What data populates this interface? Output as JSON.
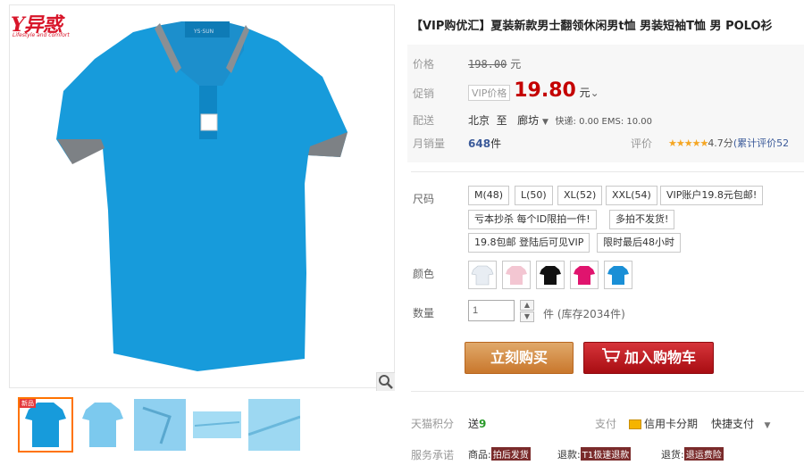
{
  "brand": {
    "logo": "Y异惑",
    "tagline": "Lifestyle and comfort"
  },
  "product": {
    "title": "【VIP购优汇】夏装新款男士翻领休闲男t恤 男装短袖T恤 男 POLO衫",
    "collar_label": "YS·SUN"
  },
  "price": {
    "label": "价格",
    "original": "198.00",
    "currency": "元"
  },
  "promo": {
    "label": "促销",
    "vip_badge": "VIP价格",
    "price": "19.80",
    "unit": "元"
  },
  "shipping": {
    "label": "配送",
    "from": "北京",
    "to_word": "至",
    "dest": "廊坊",
    "fee": "快递: 0.00 EMS: 10.00"
  },
  "sales": {
    "label": "月销量",
    "count": "648",
    "unit": "件",
    "rating_label": "评价",
    "stars": "★★★★★",
    "score": "4.7分",
    "reviews": "(累计评价52"
  },
  "sizes": {
    "label": "尺码",
    "options": [
      "M(48)",
      "L(50)",
      "XL(52)",
      "XXL(54)",
      "VIP账户19.8元包邮!"
    ]
  },
  "notes": [
    "亏本抄杀 每个ID限拍一件!",
    "多拍不发货!",
    "19.8包邮 登陆后可见VIP",
    "限时最后48小时"
  ],
  "colors": {
    "label": "颜色",
    "values": [
      "#e8edf3",
      "#f3c6d2",
      "#111111",
      "#e0146e",
      "#1a8fd6"
    ]
  },
  "quantity": {
    "label": "数量",
    "value": "1",
    "unit": "件",
    "stock": "(库存2034件)"
  },
  "actions": {
    "buy": "立刻购买",
    "cart": "加入购物车"
  },
  "points": {
    "label": "天猫积分",
    "give": "送",
    "value": "9"
  },
  "pay": {
    "label": "支付",
    "credit": "信用卡分期",
    "express": "快捷支付"
  },
  "service": {
    "label": "服务承诺",
    "item1_pre": "商品:",
    "item1_tag": "拍后发货",
    "item2_pre": "退款:",
    "item2_tag": "T1极速退款",
    "item3_pre": "退货:",
    "item3_tag": "退运费险"
  },
  "thumbs": {
    "new_tag": "新品"
  }
}
